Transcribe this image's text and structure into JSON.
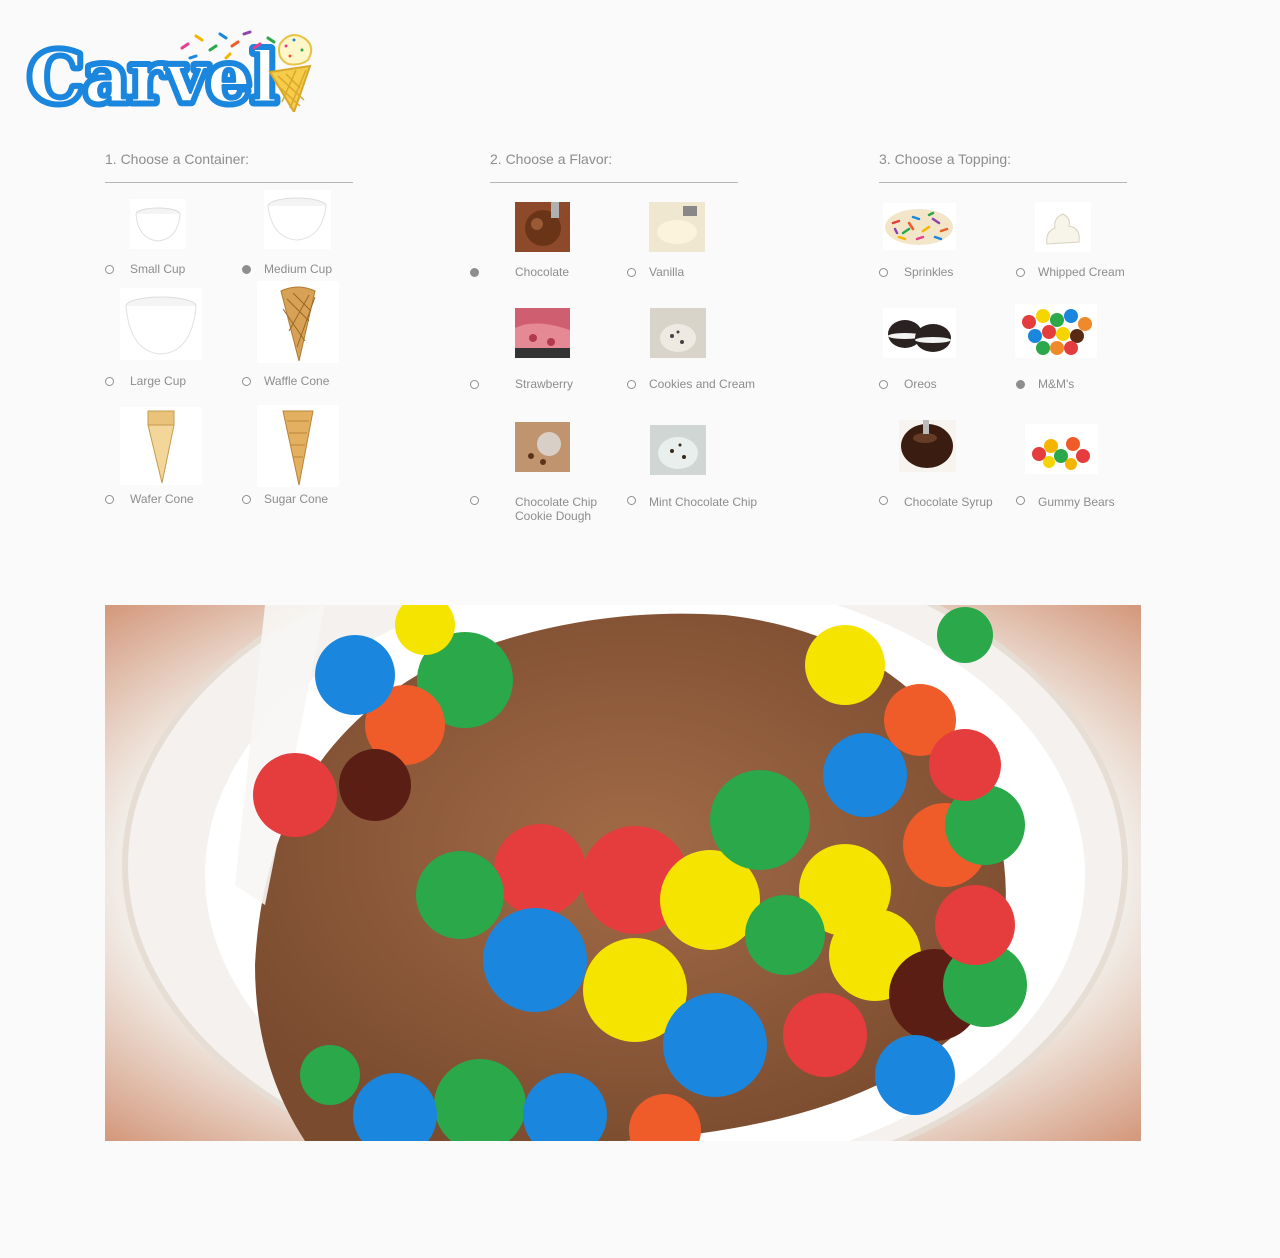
{
  "brand": {
    "name": "Carvel"
  },
  "sections": [
    {
      "title": "1. Choose a Container:",
      "options": [
        {
          "label": "Small Cup",
          "selected": false,
          "icon": "small-cup-image"
        },
        {
          "label": "Medium Cup",
          "selected": true,
          "icon": "medium-cup-image"
        },
        {
          "label": "Large Cup",
          "selected": false,
          "icon": "large-cup-image"
        },
        {
          "label": "Waffle Cone",
          "selected": false,
          "icon": "waffle-cone-image"
        },
        {
          "label": "Wafer Cone",
          "selected": false,
          "icon": "wafer-cone-image"
        },
        {
          "label": "Sugar Cone",
          "selected": false,
          "icon": "sugar-cone-image"
        }
      ]
    },
    {
      "title": "2. Choose a Flavor:",
      "options": [
        {
          "label": "Chocolate",
          "selected": true,
          "icon": "chocolate-image"
        },
        {
          "label": "Vanilla",
          "selected": false,
          "icon": "vanilla-image"
        },
        {
          "label": "Strawberry",
          "selected": false,
          "icon": "strawberry-image"
        },
        {
          "label": "Cookies and Cream",
          "selected": false,
          "icon": "cookies-and-cream-image"
        },
        {
          "label_line1": "Chocolate Chip",
          "label_line2": "Cookie Dough",
          "selected": false,
          "icon": "chocolate-chip-cookie-dough-image"
        },
        {
          "label": "Mint Chocolate Chip",
          "selected": false,
          "icon": "mint-chocolate-chip-image"
        }
      ]
    },
    {
      "title": "3. Choose a Topping:",
      "options": [
        {
          "label": "Sprinkles",
          "selected": false,
          "icon": "sprinkles-image"
        },
        {
          "label": "Whipped Cream",
          "selected": false,
          "icon": "whipped-cream-image"
        },
        {
          "label": "Oreos",
          "selected": false,
          "icon": "oreos-image"
        },
        {
          "label": "M&M's",
          "selected": true,
          "icon": "mms-image"
        },
        {
          "label": "Chocolate Syrup",
          "selected": false,
          "icon": "chocolate-syrup-image"
        },
        {
          "label": "Gummy Bears",
          "selected": false,
          "icon": "gummy-bears-image"
        }
      ]
    }
  ],
  "preview": {
    "icon": "sundae-preview-photo"
  },
  "colors": {
    "brand_blue": "#1f8fe3",
    "radio_checked": "#8e8e8e",
    "text_gray": "#8d8d8d",
    "background": "#fafafa"
  }
}
